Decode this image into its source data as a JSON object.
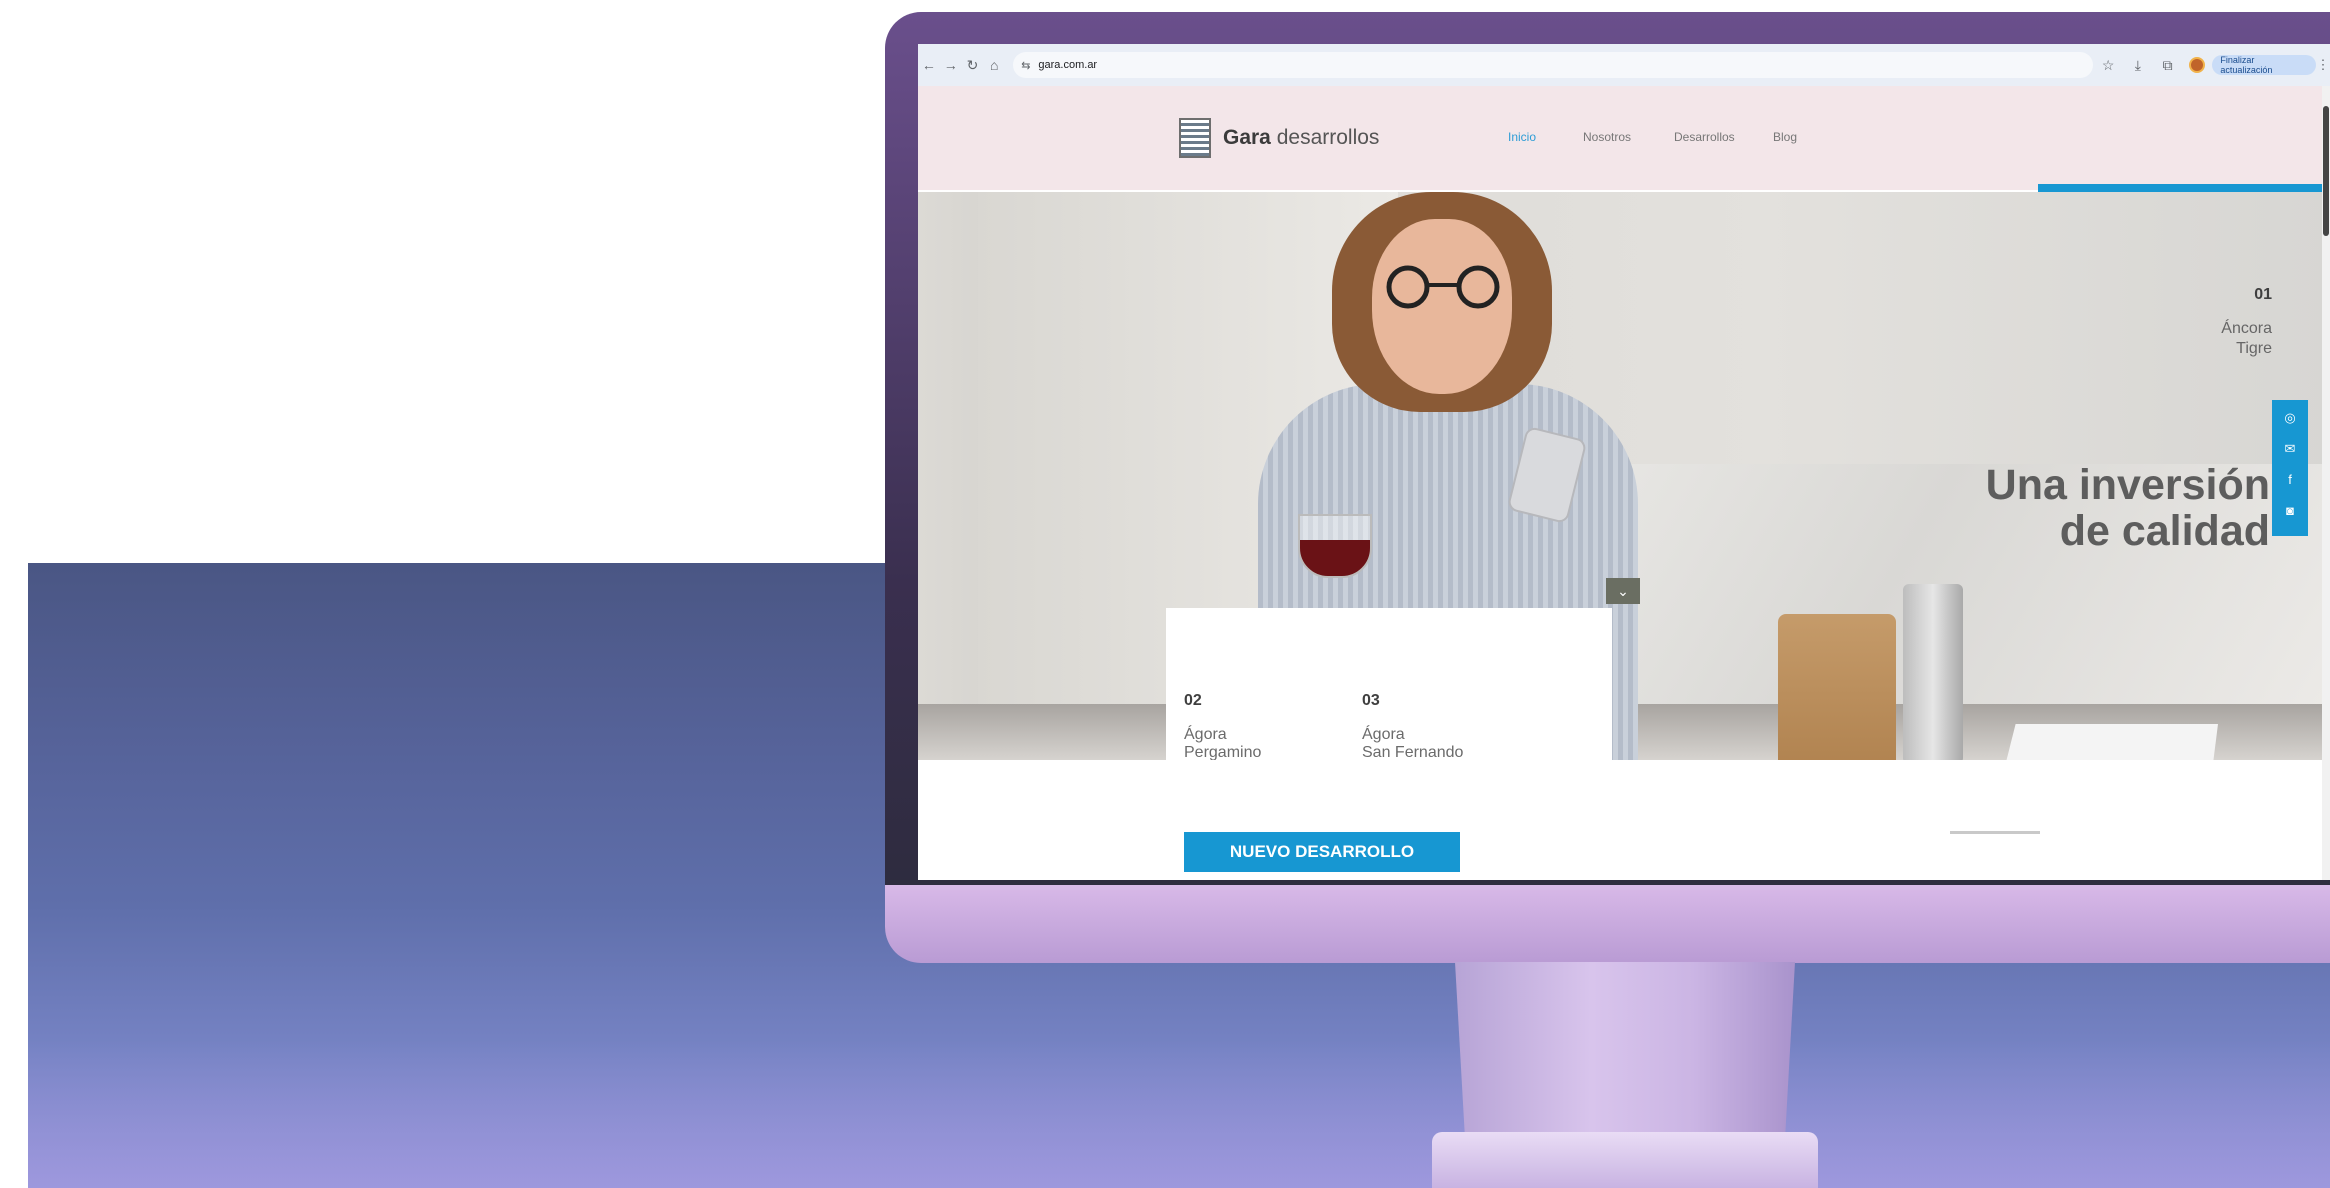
{
  "browser": {
    "url": "gara.com.ar",
    "update_button": "Finalizar actualización",
    "icons": [
      "back-arrow-icon",
      "forward-arrow-icon",
      "reload-icon",
      "home-icon",
      "site-settings-icon",
      "star-icon",
      "download-icon",
      "extension-icon",
      "profile-avatar",
      "kebab-menu-icon"
    ]
  },
  "site": {
    "logo_bold": "Gara",
    "logo_light": " desarrollos",
    "nav": [
      "Inicio",
      "Nosotros",
      "Desarrollos",
      "Blog"
    ],
    "active_nav": "Inicio",
    "accent_color": "#1797d2"
  },
  "hero": {
    "slide_number": "01",
    "slide_line1": "Áncora",
    "slide_line2": "Tigre",
    "title_line1": "Una inversión",
    "title_line2": "de calidad",
    "scroll_icon": "chevron-down-icon"
  },
  "social": [
    "whatsapp-icon",
    "mail-icon",
    "facebook-icon",
    "instagram-icon"
  ],
  "projects": [
    {
      "number": "02",
      "line1": "Ágora",
      "line2": "Pergamino"
    },
    {
      "number": "03",
      "line1": "Ágora",
      "line2": "San Fernando"
    }
  ],
  "cta": {
    "label": "NUEVO DESARROLLO"
  }
}
